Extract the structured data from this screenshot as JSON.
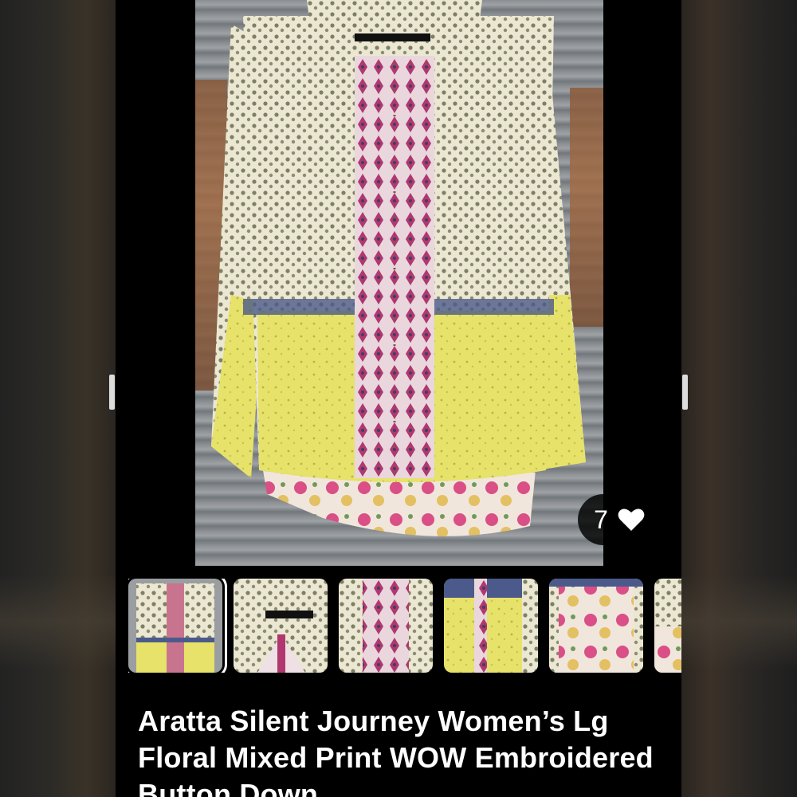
{
  "listing": {
    "title": "Aratta Silent Journey Women’s Lg Floral Mixed Print WOW Embroidered Button Down"
  },
  "likes": {
    "count": "7",
    "icon": "heart-icon"
  },
  "gallery": {
    "total_visible_thumbnails": 6,
    "selected_index": 0
  },
  "colors": {
    "background": "#000000",
    "text": "#ffffff",
    "shirt_yellow": "#e6e26a",
    "shirt_cream": "#ece7d2",
    "placket_pink": "#b0386e"
  }
}
